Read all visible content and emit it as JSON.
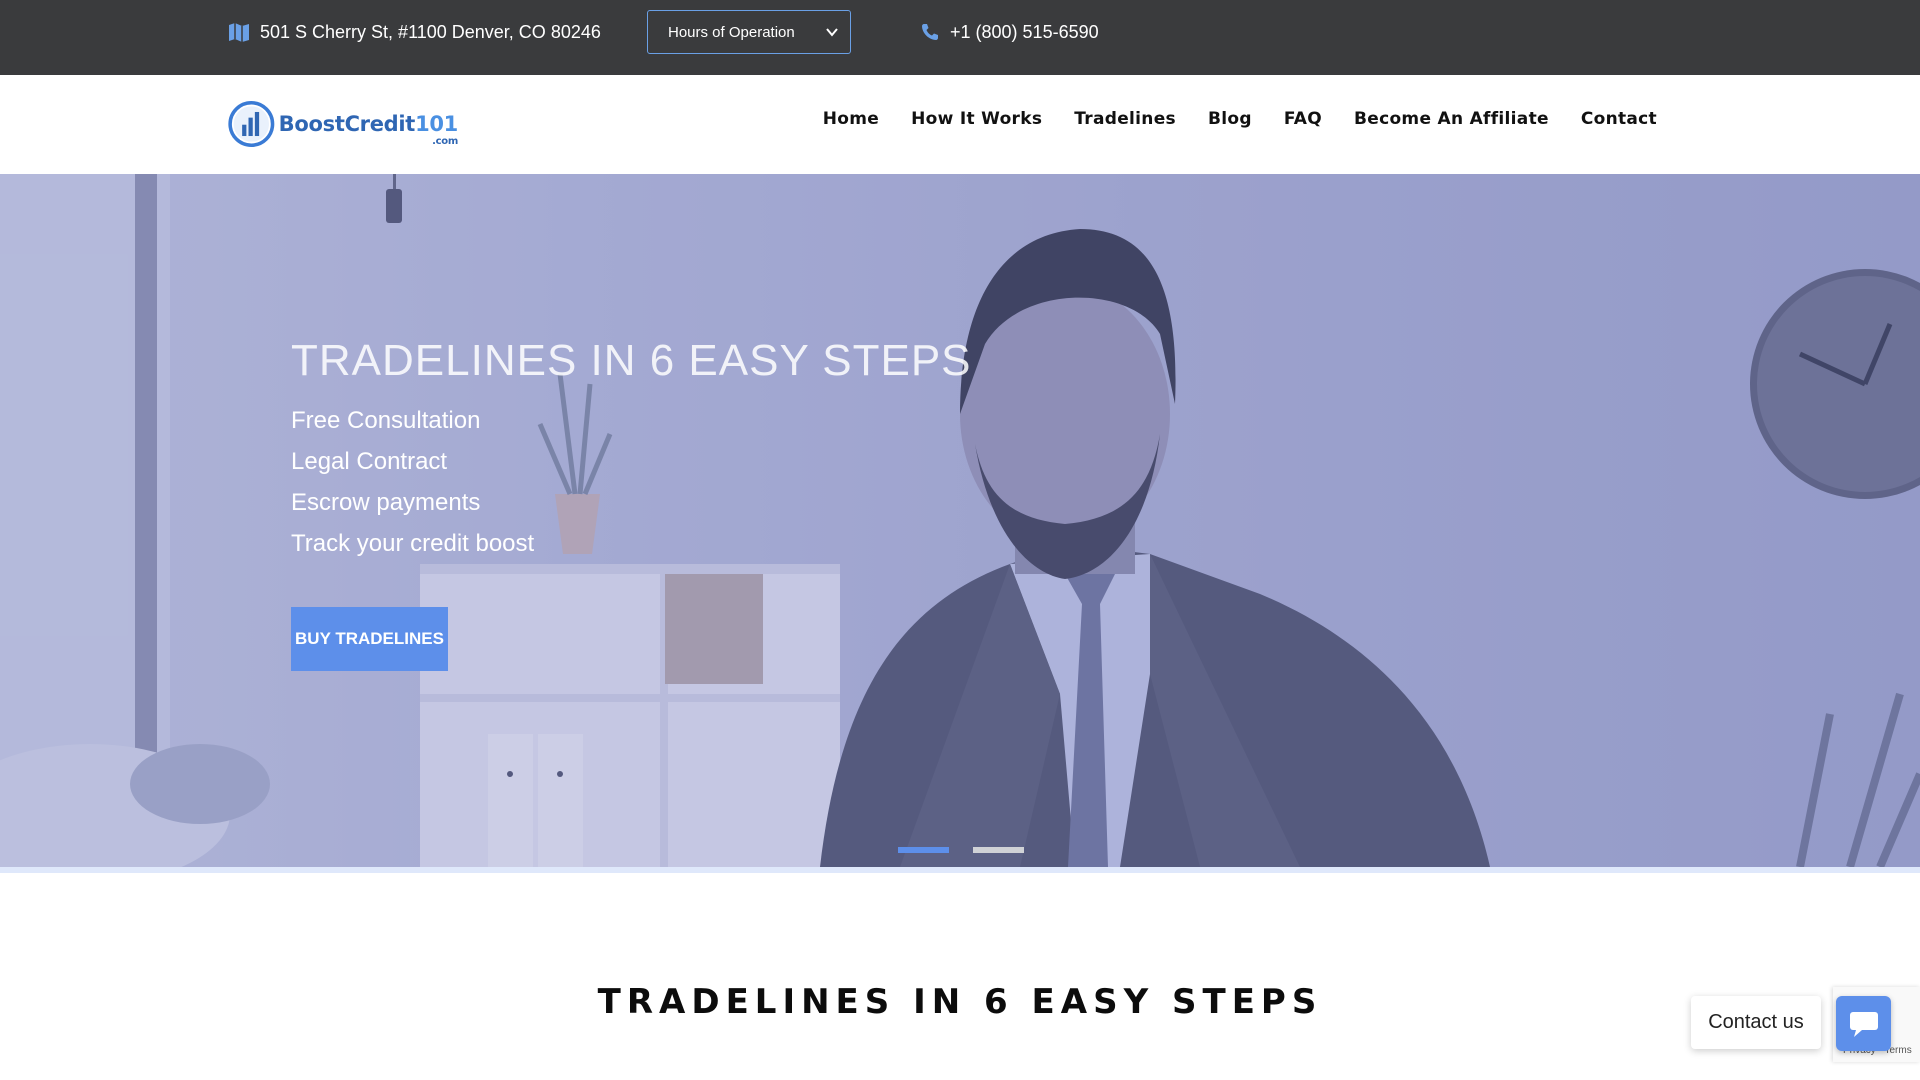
{
  "topbar": {
    "address": "501 S Cherry St, #1100 Denver, CO 80246",
    "hours_select": "Hours of Operation",
    "phone": "+1 (800) 515-6590",
    "icons": {
      "address": "map-icon",
      "phone": "phone-icon"
    }
  },
  "header": {
    "logo_text": "BoostCredit",
    "logo_number": "101",
    "logo_suffix": ".com",
    "nav": [
      "Home",
      "How It Works",
      "Tradelines",
      "Blog",
      "FAQ",
      "Become An Affiliate",
      "Contact"
    ]
  },
  "hero": {
    "title": "TRADELINES IN 6 EASY STEPS",
    "steps": [
      "Free Consultation",
      "Legal Contract",
      "Escrow payments",
      "Track your credit boost"
    ],
    "button": "BUY TRADELINES",
    "slides": 2,
    "active_slide": 1
  },
  "section": {
    "title": "TRADELINES IN 6 EASY STEPS"
  },
  "widget": {
    "contact_label": "Contact us",
    "recaptcha_text": "Privacy - Terms"
  },
  "colors": {
    "topbar": "#3a3b3d",
    "accent": "#5d8fea",
    "brand": "#2f66b3"
  }
}
